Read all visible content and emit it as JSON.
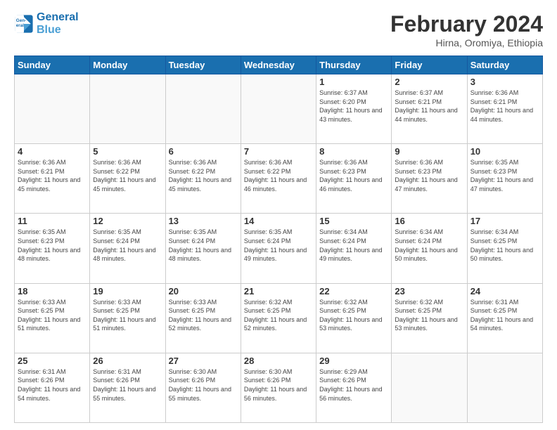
{
  "header": {
    "logo_line1": "General",
    "logo_line2": "Blue",
    "month_title": "February 2024",
    "location": "Hirna, Oromiya, Ethiopia"
  },
  "weekdays": [
    "Sunday",
    "Monday",
    "Tuesday",
    "Wednesday",
    "Thursday",
    "Friday",
    "Saturday"
  ],
  "weeks": [
    [
      {
        "day": "",
        "sunrise": "",
        "sunset": "",
        "daylight": ""
      },
      {
        "day": "",
        "sunrise": "",
        "sunset": "",
        "daylight": ""
      },
      {
        "day": "",
        "sunrise": "",
        "sunset": "",
        "daylight": ""
      },
      {
        "day": "",
        "sunrise": "",
        "sunset": "",
        "daylight": ""
      },
      {
        "day": "1",
        "sunrise": "Sunrise: 6:37 AM",
        "sunset": "Sunset: 6:20 PM",
        "daylight": "Daylight: 11 hours and 43 minutes."
      },
      {
        "day": "2",
        "sunrise": "Sunrise: 6:37 AM",
        "sunset": "Sunset: 6:21 PM",
        "daylight": "Daylight: 11 hours and 44 minutes."
      },
      {
        "day": "3",
        "sunrise": "Sunrise: 6:36 AM",
        "sunset": "Sunset: 6:21 PM",
        "daylight": "Daylight: 11 hours and 44 minutes."
      }
    ],
    [
      {
        "day": "4",
        "sunrise": "Sunrise: 6:36 AM",
        "sunset": "Sunset: 6:21 PM",
        "daylight": "Daylight: 11 hours and 45 minutes."
      },
      {
        "day": "5",
        "sunrise": "Sunrise: 6:36 AM",
        "sunset": "Sunset: 6:22 PM",
        "daylight": "Daylight: 11 hours and 45 minutes."
      },
      {
        "day": "6",
        "sunrise": "Sunrise: 6:36 AM",
        "sunset": "Sunset: 6:22 PM",
        "daylight": "Daylight: 11 hours and 45 minutes."
      },
      {
        "day": "7",
        "sunrise": "Sunrise: 6:36 AM",
        "sunset": "Sunset: 6:22 PM",
        "daylight": "Daylight: 11 hours and 46 minutes."
      },
      {
        "day": "8",
        "sunrise": "Sunrise: 6:36 AM",
        "sunset": "Sunset: 6:23 PM",
        "daylight": "Daylight: 11 hours and 46 minutes."
      },
      {
        "day": "9",
        "sunrise": "Sunrise: 6:36 AM",
        "sunset": "Sunset: 6:23 PM",
        "daylight": "Daylight: 11 hours and 47 minutes."
      },
      {
        "day": "10",
        "sunrise": "Sunrise: 6:35 AM",
        "sunset": "Sunset: 6:23 PM",
        "daylight": "Daylight: 11 hours and 47 minutes."
      }
    ],
    [
      {
        "day": "11",
        "sunrise": "Sunrise: 6:35 AM",
        "sunset": "Sunset: 6:23 PM",
        "daylight": "Daylight: 11 hours and 48 minutes."
      },
      {
        "day": "12",
        "sunrise": "Sunrise: 6:35 AM",
        "sunset": "Sunset: 6:24 PM",
        "daylight": "Daylight: 11 hours and 48 minutes."
      },
      {
        "day": "13",
        "sunrise": "Sunrise: 6:35 AM",
        "sunset": "Sunset: 6:24 PM",
        "daylight": "Daylight: 11 hours and 48 minutes."
      },
      {
        "day": "14",
        "sunrise": "Sunrise: 6:35 AM",
        "sunset": "Sunset: 6:24 PM",
        "daylight": "Daylight: 11 hours and 49 minutes."
      },
      {
        "day": "15",
        "sunrise": "Sunrise: 6:34 AM",
        "sunset": "Sunset: 6:24 PM",
        "daylight": "Daylight: 11 hours and 49 minutes."
      },
      {
        "day": "16",
        "sunrise": "Sunrise: 6:34 AM",
        "sunset": "Sunset: 6:24 PM",
        "daylight": "Daylight: 11 hours and 50 minutes."
      },
      {
        "day": "17",
        "sunrise": "Sunrise: 6:34 AM",
        "sunset": "Sunset: 6:25 PM",
        "daylight": "Daylight: 11 hours and 50 minutes."
      }
    ],
    [
      {
        "day": "18",
        "sunrise": "Sunrise: 6:33 AM",
        "sunset": "Sunset: 6:25 PM",
        "daylight": "Daylight: 11 hours and 51 minutes."
      },
      {
        "day": "19",
        "sunrise": "Sunrise: 6:33 AM",
        "sunset": "Sunset: 6:25 PM",
        "daylight": "Daylight: 11 hours and 51 minutes."
      },
      {
        "day": "20",
        "sunrise": "Sunrise: 6:33 AM",
        "sunset": "Sunset: 6:25 PM",
        "daylight": "Daylight: 11 hours and 52 minutes."
      },
      {
        "day": "21",
        "sunrise": "Sunrise: 6:32 AM",
        "sunset": "Sunset: 6:25 PM",
        "daylight": "Daylight: 11 hours and 52 minutes."
      },
      {
        "day": "22",
        "sunrise": "Sunrise: 6:32 AM",
        "sunset": "Sunset: 6:25 PM",
        "daylight": "Daylight: 11 hours and 53 minutes."
      },
      {
        "day": "23",
        "sunrise": "Sunrise: 6:32 AM",
        "sunset": "Sunset: 6:25 PM",
        "daylight": "Daylight: 11 hours and 53 minutes."
      },
      {
        "day": "24",
        "sunrise": "Sunrise: 6:31 AM",
        "sunset": "Sunset: 6:25 PM",
        "daylight": "Daylight: 11 hours and 54 minutes."
      }
    ],
    [
      {
        "day": "25",
        "sunrise": "Sunrise: 6:31 AM",
        "sunset": "Sunset: 6:26 PM",
        "daylight": "Daylight: 11 hours and 54 minutes."
      },
      {
        "day": "26",
        "sunrise": "Sunrise: 6:31 AM",
        "sunset": "Sunset: 6:26 PM",
        "daylight": "Daylight: 11 hours and 55 minutes."
      },
      {
        "day": "27",
        "sunrise": "Sunrise: 6:30 AM",
        "sunset": "Sunset: 6:26 PM",
        "daylight": "Daylight: 11 hours and 55 minutes."
      },
      {
        "day": "28",
        "sunrise": "Sunrise: 6:30 AM",
        "sunset": "Sunset: 6:26 PM",
        "daylight": "Daylight: 11 hours and 56 minutes."
      },
      {
        "day": "29",
        "sunrise": "Sunrise: 6:29 AM",
        "sunset": "Sunset: 6:26 PM",
        "daylight": "Daylight: 11 hours and 56 minutes."
      },
      {
        "day": "",
        "sunrise": "",
        "sunset": "",
        "daylight": ""
      },
      {
        "day": "",
        "sunrise": "",
        "sunset": "",
        "daylight": ""
      }
    ]
  ]
}
